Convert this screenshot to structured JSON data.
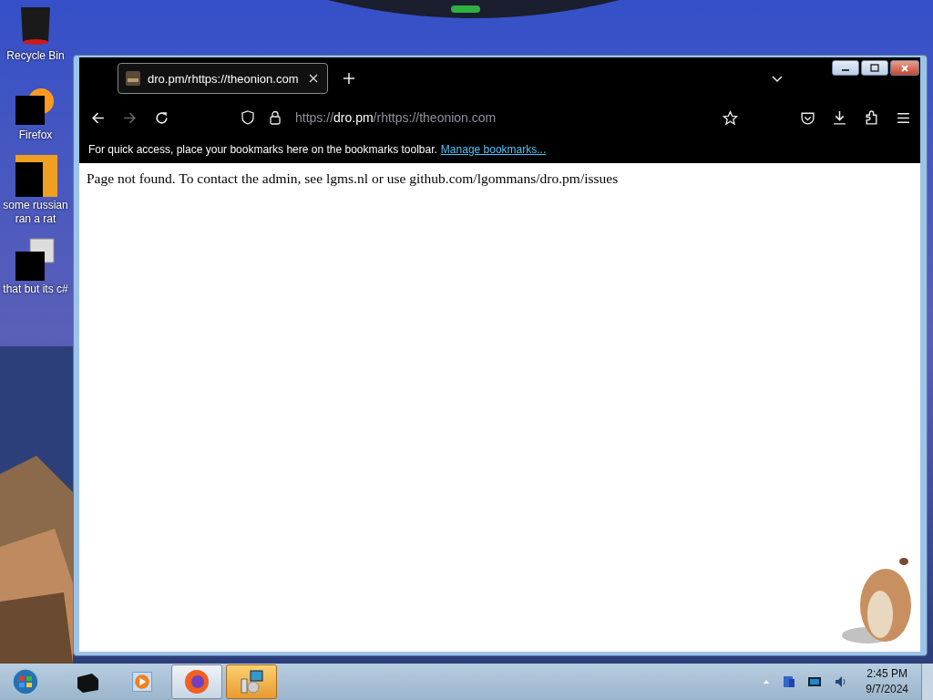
{
  "desktop_icons": [
    {
      "kind": "bin",
      "label": "Recycle Bin"
    },
    {
      "kind": "firefox",
      "label": "Firefox"
    },
    {
      "kind": "doc",
      "label": "some russian ran a rat"
    },
    {
      "kind": "stack",
      "label": "that but its c#"
    }
  ],
  "browser": {
    "tabs": [
      {
        "title": "dro.pm/rhttps://theonion.com",
        "selected": true
      }
    ],
    "back": {
      "disabled": false
    },
    "forward": {
      "disabled": true
    },
    "address": {
      "scheme": "https://",
      "host": "dro.pm",
      "path": "/rhttps://theonion.com"
    },
    "bookmarks_bar": {
      "text": "For quick access, place your bookmarks here on the bookmarks toolbar.",
      "link": "Manage bookmarks..."
    },
    "page_text": "Page not found. To contact the admin, see lgms.nl or use github.com/lgommans/dro.pm/issues"
  },
  "taskbar": {
    "items": [
      {
        "kind": "box",
        "selected": false,
        "running": false
      },
      {
        "kind": "media",
        "selected": false,
        "running": false
      },
      {
        "kind": "firefox",
        "selected": false,
        "running": true
      },
      {
        "kind": "installer",
        "selected": true,
        "running": true
      }
    ],
    "clock": {
      "time": "2:45 PM",
      "date": "9/7/2024"
    }
  }
}
